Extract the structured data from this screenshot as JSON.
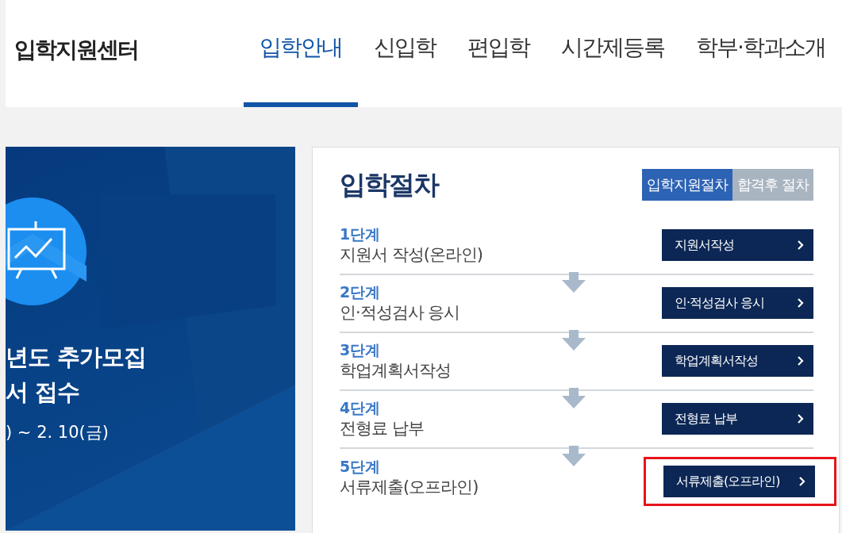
{
  "header": {
    "logo": "입학지원센터",
    "nav": [
      {
        "label": "입학안내",
        "selected": true
      },
      {
        "label": "신입학",
        "selected": false
      },
      {
        "label": "편입학",
        "selected": false
      },
      {
        "label": "시간제등록",
        "selected": false
      },
      {
        "label": "학부·학과소개",
        "selected": false
      }
    ]
  },
  "banner": {
    "title_lines": [
      "년도 추가모집",
      "서 접수"
    ],
    "period": ") ~ 2. 10(금)"
  },
  "procedure": {
    "title": "입학절차",
    "tabs": [
      {
        "label": "입학지원절차",
        "selected": true
      },
      {
        "label": "합격후 절차",
        "selected": false
      }
    ],
    "steps": [
      {
        "step": "1단계",
        "description": "지원서 작성(온라인)",
        "button": "지원서작성",
        "highlighted": false
      },
      {
        "step": "2단계",
        "description": "인·적성검사 응시",
        "button": "인·적성검사 응시",
        "highlighted": false
      },
      {
        "step": "3단계",
        "description": "학업계획서작성",
        "button": "학업계획서작성",
        "highlighted": false
      },
      {
        "step": "4단계",
        "description": "전형료 납부",
        "button": "전형료 납부",
        "highlighted": false
      },
      {
        "step": "5단계",
        "description": "서류제출(오프라인)",
        "button": "서류제출(오프라인)",
        "highlighted": true
      }
    ]
  }
}
